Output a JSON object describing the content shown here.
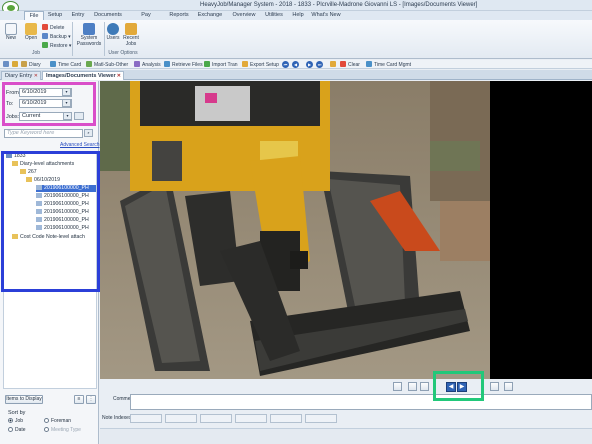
{
  "window": {
    "title": "HeavyJob/Manager System - 2018 - 1833 - Plcrville-Madrone Giovanni LS - [Images/Documents Viewer]"
  },
  "menu": [
    "File",
    "Setup",
    "Entry",
    "Documents",
    "Pay Estimate",
    "Reports",
    "Exchange",
    "Overview",
    "Utilities",
    "Help",
    "What's New"
  ],
  "ribbon": {
    "new_label": "New",
    "open_label": "Open",
    "delete_label": "Delete",
    "backup_label": "Backup",
    "restore_label": "Restore",
    "job_group": "Job",
    "system_passwords": "System Passwords",
    "users_label": "Users",
    "recent_jobs": "Recent Jobs",
    "user_options_group": "User Options"
  },
  "toolbar": [
    "Diary",
    "Time Card",
    "Matl-Sub-Other",
    "Analysis",
    "Retrieve Files",
    "Import Tran",
    "Export Setup",
    "Clear",
    "Time Card Mgmt"
  ],
  "tabs": {
    "tab1": "Diary Entry",
    "tab2": "Images/Documents Viewer"
  },
  "filters": {
    "from_label": "From:",
    "from_value": "6/10/2019",
    "to_label": "To:",
    "to_value": "6/10/2019",
    "jobs_label": "Jobs:",
    "jobs_value": "Current",
    "search_placeholder": "Type Keyword here",
    "advanced_search": "Advanced Search"
  },
  "tree": {
    "root": "1833",
    "diary_attachments": "Diary-level attachments",
    "folder": "267",
    "date": "06/10/2019",
    "files": [
      "201906100000_PH",
      "201906100000_PH",
      "201906100000_PH",
      "201906100000_PH",
      "201906100000_PH",
      "201906100000_PH"
    ],
    "cost_code": "Cost Code Note-level attach"
  },
  "left_footer": {
    "items_to_display": "Items to Display",
    "sort_by": "Sort by",
    "job": "Job",
    "foreman": "Foreman",
    "date": "Date",
    "meeting_type": "Meeting Type"
  },
  "viewer": {
    "comments_label": "Comments:",
    "note_indexes_label": "Note Indexes:"
  },
  "annotation_colors": {
    "pink": "#d94fc9",
    "blue": "#2b3fd8",
    "green": "#22c87a"
  }
}
